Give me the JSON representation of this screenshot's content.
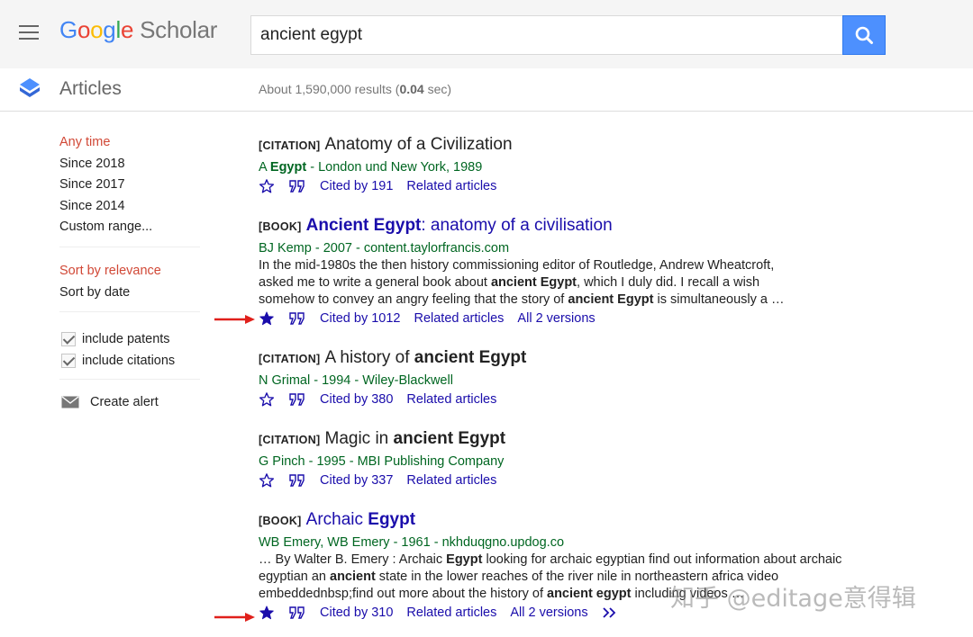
{
  "header": {
    "logo": {
      "google": [
        "G",
        "o",
        "o",
        "g",
        "l",
        "e"
      ],
      "scholar": "Scholar"
    },
    "search_value": "ancient egypt"
  },
  "subheader": {
    "section": "Articles",
    "stats_prefix": "About 1,590,000 results (",
    "stats_time": "0.04",
    "stats_suffix": " sec)"
  },
  "sidebar": {
    "time_filters": [
      "Any time",
      "Since 2018",
      "Since 2017",
      "Since 2014",
      "Custom range..."
    ],
    "sort_options": [
      "Sort by relevance",
      "Sort by date"
    ],
    "checkboxes": [
      "include patents",
      "include citations"
    ],
    "create_alert": "Create alert"
  },
  "results": [
    {
      "tag": "[CITATION]",
      "title_parts": [
        "Anatomy of a Civilization"
      ],
      "meta_a": "A ",
      "meta_b": "Egypt",
      "meta_c": " - London und New York, 1989",
      "cited": "Cited by 191",
      "related": "Related articles"
    },
    {
      "tag": "[BOOK]",
      "title_bold": "Ancient Egypt",
      "title_rest": ": anatomy of a civilisation",
      "meta": "BJ Kemp - 2007 - content.taylorfrancis.com",
      "snippet": {
        "l1": "In the mid-1980s the then history commissioning editor of Routledge, Andrew Wheatcroft,",
        "l2a": "asked me to write a general book about ",
        "l2b": "ancient Egypt",
        "l2c": ", which I duly did. I recall a wish",
        "l3a": "somehow to convey an angry feeling that the story of ",
        "l3b": "ancient Egypt",
        "l3c": " is simultaneously a …"
      },
      "cited": "Cited by 1012",
      "related": "Related articles",
      "versions": "All 2 versions"
    },
    {
      "tag": "[CITATION]",
      "title_plain": "A history of ",
      "title_bold": "ancient Egypt",
      "meta": "N Grimal - 1994 - Wiley-Blackwell",
      "cited": "Cited by 380",
      "related": "Related articles"
    },
    {
      "tag": "[CITATION]",
      "title_plain": "Magic in ",
      "title_bold": "ancient Egypt",
      "meta": "G Pinch - 1995 - MBI Publishing Company",
      "cited": "Cited by 337",
      "related": "Related articles"
    },
    {
      "tag": "[BOOK]",
      "title_plain": "Archaic ",
      "title_bold": "Egypt",
      "meta": "WB Emery, WB Emery - 1961 - nkhduqgno.updog.co",
      "snippet": {
        "l1a": "… By Walter B. Emery : Archaic ",
        "l1b": "Egypt",
        "l1c": " looking for archaic egyptian find out information about archaic",
        "l2a": "egyptian an ",
        "l2b": "ancient",
        "l2c": " state in the lower reaches of the river nile in northeastern africa video",
        "l3a": "embeddednbsp;find out more about the history of ",
        "l3b": "ancient egypt",
        "l3c": " including videos …"
      },
      "cited": "Cited by 310",
      "related": "Related articles",
      "versions": "All 2 versions"
    }
  ],
  "watermark": "知乎 @editage意得辑",
  "colors": {
    "link": "#1a0dab",
    "meta_green": "#006621",
    "active_red": "#d14836",
    "search_blue": "#4d90fe",
    "arrow_red": "#e0201b",
    "star_saved": "#1a0dab"
  }
}
